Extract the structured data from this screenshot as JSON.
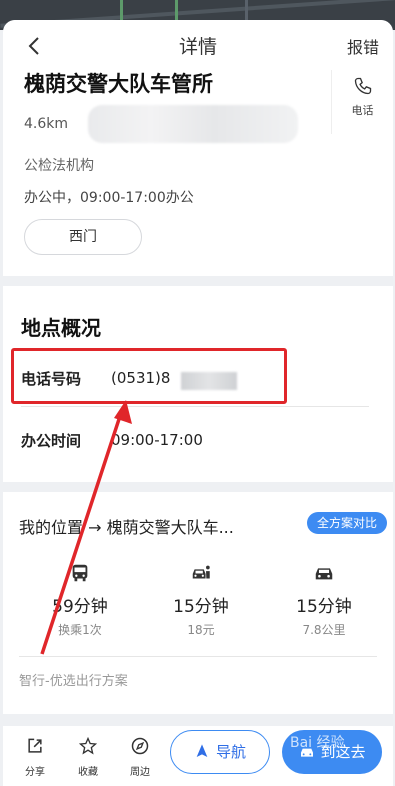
{
  "header": {
    "title": "详情",
    "report_label": "报错"
  },
  "poi": {
    "name": "槐荫交警大队车管所",
    "distance": "4.6km",
    "category": "公检法机构",
    "status_hours": "办公中，09:00-17:00办公",
    "gate_button": "西门",
    "phone_label": "电话"
  },
  "overview": {
    "title": "地点概况",
    "phone_key": "电话号码",
    "phone_value": "(0531)8",
    "hours_key": "办公时间",
    "hours_value": "09:00-17:00"
  },
  "route": {
    "header": "我的位置 → 槐荫交警大队车...",
    "compare_label": "全方案对比",
    "modes": [
      {
        "icon": "bus-icon",
        "time": "59分钟",
        "sub": "换乘1次"
      },
      {
        "icon": "taxi-icon",
        "time": "15分钟",
        "sub": "18元"
      },
      {
        "icon": "car-icon",
        "time": "15分钟",
        "sub": "7.8公里"
      }
    ],
    "smart_label": "智行-优选出行方案"
  },
  "bottom_bar": {
    "share_label": "分享",
    "favorite_label": "收藏",
    "nearby_label": "周边",
    "navigate_label": "导航",
    "go_label": "到这去"
  },
  "watermark": "Bai 经验",
  "colors": {
    "accent": "#3d8bf2",
    "highlight": "#e0262a"
  }
}
